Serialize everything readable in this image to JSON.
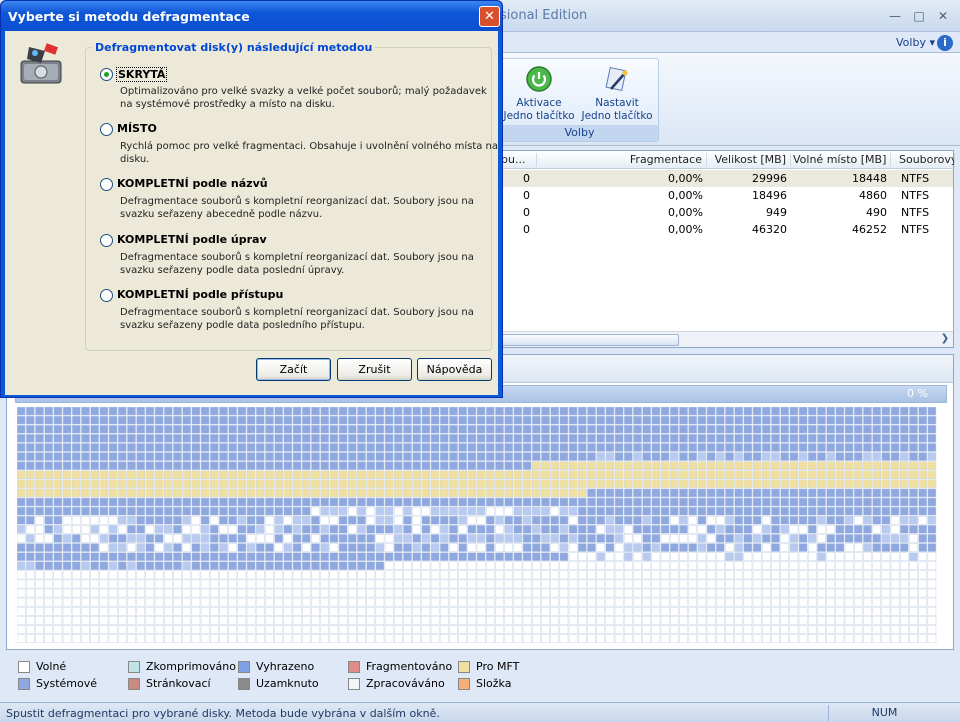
{
  "app": {
    "title_visible": "sional Edition",
    "options_label": "Volby ▾"
  },
  "ribbon": {
    "group_label": "Volby",
    "buttons": [
      {
        "label": "Aktivace Jedno tlačítko",
        "icon": "power-icon"
      },
      {
        "label": "Nastavit Jedno tlačítko",
        "icon": "wand-icon"
      }
    ]
  },
  "table": {
    "columns": [
      "pu...",
      "Fragmentace",
      "Velikost [MB]",
      "Volné místo [MB]",
      "Souborový"
    ],
    "rows": [
      {
        "a": "0",
        "frag": "0,00%",
        "size": "29996",
        "free": "18448",
        "fs": "NTFS",
        "selected": true
      },
      {
        "a": "0",
        "frag": "0,00%",
        "size": "18496",
        "free": "4860",
        "fs": "NTFS",
        "selected": false
      },
      {
        "a": "0",
        "frag": "0,00%",
        "size": "949",
        "free": "490",
        "fs": "NTFS",
        "selected": false
      },
      {
        "a": "0",
        "frag": "0,00%",
        "size": "46320",
        "free": "46252",
        "fs": "NTFS",
        "selected": false
      }
    ]
  },
  "map": {
    "percent": "0 %",
    "progress": 0
  },
  "legend": [
    {
      "label": "Volné",
      "color": "#ffffff"
    },
    {
      "label": "Zkomprimováno",
      "color": "#bfe3e6"
    },
    {
      "label": "Vyhrazeno",
      "color": "#7e9fe6"
    },
    {
      "label": "Fragmentováno",
      "color": "#e08a8a"
    },
    {
      "label": "Pro MFT",
      "color": "#f0e0a0"
    },
    {
      "label": "Systémové",
      "color": "#8fa8e0"
    },
    {
      "label": "Stránkovací",
      "color": "#c98a80"
    },
    {
      "label": "Uzamknuto",
      "color": "#8a8a8a"
    },
    {
      "label": "Zpracováváno",
      "color": "#f2f4f8"
    },
    {
      "label": "Složka",
      "color": "#f5b07a"
    }
  ],
  "status": {
    "text": "Spustit defragmentaci pro vybrané disky. Metoda bude vybrána v dalším okně.",
    "num": "NUM"
  },
  "dialog": {
    "title": "Vyberte si metodu defragmentace",
    "group_title": "Defragmentovat disk(y) následující metodou",
    "options": [
      {
        "label": "SKRYTÁ",
        "desc": "Optimalizováno pro velké svazky a velké počet souborů; malý požadavek na systémové prostředky a místo na disku.",
        "selected": true
      },
      {
        "label": "MÍSTO",
        "desc": "Rychlá pomoc pro velké fragmentaci. Obsahuje i uvolnění volného místa na disku.",
        "selected": false
      },
      {
        "label": "KOMPLETNÍ podle názvů",
        "desc": "Defragmentace souborů s kompletní reorganizací dat. Soubory jsou na svazku seřazeny abecedně podle názvu.",
        "selected": false
      },
      {
        "label": "KOMPLETNÍ podle úprav",
        "desc": "Defragmentace souborů s kompletní reorganizací dat. Soubory jsou na svazku seřazeny podle data poslední úpravy.",
        "selected": false
      },
      {
        "label": "KOMPLETNÍ podle přístupu",
        "desc": "Defragmentace souborů s kompletní reorganizací dat. Soubory jsou na svazku seřazeny podle data posledního přístupu.",
        "selected": false
      }
    ],
    "buttons": {
      "start": "Začít",
      "cancel": "Zrušit",
      "help": "Nápověda"
    }
  }
}
